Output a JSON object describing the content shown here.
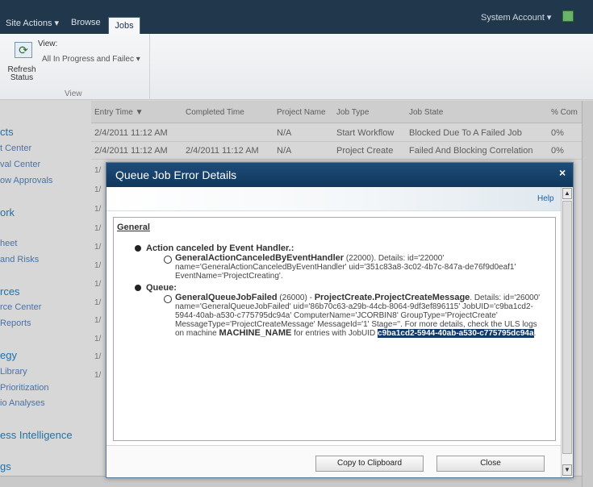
{
  "topbar": {
    "tabs": [
      "Site Actions ▾",
      "Browse"
    ],
    "active_tab": "Jobs",
    "account": "System Account ▾"
  },
  "ribbon": {
    "refresh_label": "Refresh Status",
    "view_label": "View:",
    "view_selected": "All In Progress and Failec ▾",
    "group_label": "View"
  },
  "leftnav": {
    "items": [
      {
        "text": "cts",
        "kind": "heading"
      },
      {
        "text": "t Center",
        "kind": "item"
      },
      {
        "text": "val Center",
        "kind": "item"
      },
      {
        "text": "ow Approvals",
        "kind": "item"
      },
      {
        "text": "ork",
        "kind": "heading"
      },
      {
        "text": "heet",
        "kind": "item"
      },
      {
        "text": "and Risks",
        "kind": "item"
      },
      {
        "text": "rces",
        "kind": "heading"
      },
      {
        "text": "rce Center",
        "kind": "item"
      },
      {
        "text": "Reports",
        "kind": "item"
      },
      {
        "text": "egy",
        "kind": "heading"
      },
      {
        "text": "Library",
        "kind": "item"
      },
      {
        "text": "Prioritization",
        "kind": "item"
      },
      {
        "text": "io Analyses",
        "kind": "item"
      },
      {
        "text": "ess Intelligence",
        "kind": "heading"
      },
      {
        "text": "gs",
        "kind": "heading"
      }
    ]
  },
  "grid": {
    "headers": [
      "Entry Time ▼",
      "Completed Time",
      "Project Name",
      "Job Type",
      "Job State",
      "% Com"
    ],
    "rows": [
      [
        "2/4/2011 11:12 AM",
        "",
        "N/A",
        "Start Workflow",
        "Blocked Due To A Failed Job",
        "0%"
      ],
      [
        "2/4/2011 11:12 AM",
        "2/4/2011 11:12 AM",
        "N/A",
        "Project Create",
        "Failed And Blocking Correlation",
        "0%"
      ]
    ],
    "partial_rows": [
      "1/",
      "1/",
      "1/",
      "1/",
      "1/",
      "1/",
      "1/",
      "1/",
      "1/",
      "1/",
      "1/",
      "1/"
    ]
  },
  "dialog": {
    "title": "Queue Job Error Details",
    "close": "×",
    "help": "Help",
    "section": "General",
    "error1": {
      "heading": "Action canceled by Event Handler.:",
      "name": "GeneralActionCanceledByEventHandler",
      "code": " (22000). Details: id='22000'",
      "detail": "name='GeneralActionCanceledByEventHandler' uid='351c83a8-3c02-4b7c-847a-de76f9d0eaf1' EventName='ProjectCreating'."
    },
    "error2": {
      "heading": "Queue:",
      "name": "GeneralQueueJobFailed",
      "code": " (26000) - ",
      "job": "ProjectCreate.ProjectCreateMessage",
      "detail": ". Details: id='26000' name='GeneralQueueJobFailed' uid='86b70c63-a29b-44cb-8064-9df3ef896115' JobUID='c9ba1cd2-5944-40ab-a530-c775795dc94a' ComputerName='JCORBIN8' GroupType='ProjectCreate' MessageType='ProjectCreateMessage' MessageId='1' Stage=''. For more details, check the ULS logs on machine ",
      "machine": "MACHINE_NAME",
      "middle": " for entries with JobUID ",
      "jobuid": "c9ba1cd2-5944-40ab-a530-c775795dc94a",
      "end": "."
    },
    "copy_button": "Copy to Clipboard",
    "close_button": "Close"
  }
}
